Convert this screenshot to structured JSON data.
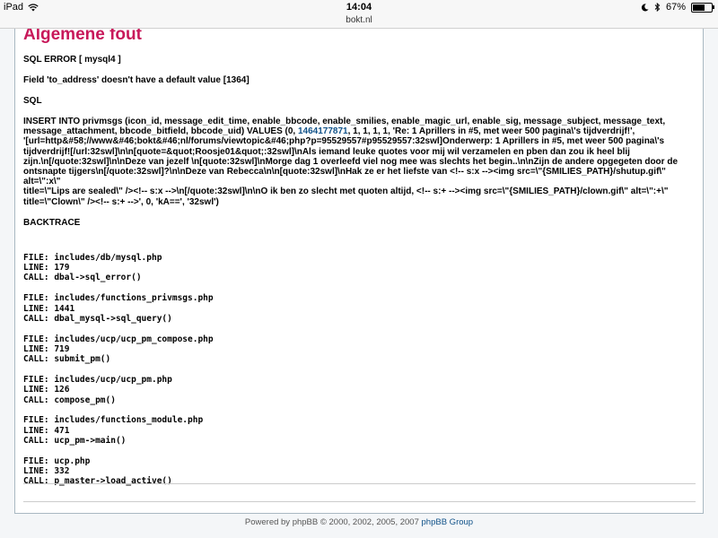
{
  "status_bar": {
    "device": "iPad",
    "time": "14:04",
    "battery": "67%"
  },
  "url_bar": {
    "domain": "bokt.nl"
  },
  "error": {
    "title": "Algemene fout",
    "sql_error": "SQL ERROR [ mysql4 ]",
    "field_message": "Field 'to_address' doesn't have a default value [1364]",
    "sql_heading": "SQL",
    "query_lines": [
      {
        "pre": "INSERT INTO privmsgs (icon_id, message_edit_time, enable_bbcode, enable_smilies, enable_magic_url, enable_sig, message_subject, message_text,",
        "link": "",
        "post": ""
      },
      {
        "pre": "message_attachment, bbcode_bitfield, bbcode_uid) VALUES (0, ",
        "link": "1464177871",
        "post": ", 1, 1, 1, 1, 'Re: 1 Aprillers in #5, met weer 500 pagina\\'s tijdverdrijf!',"
      },
      {
        "pre": "'[url=http&#58;//www&#46;bokt&#46;nl/forums/viewtopic&#46;php?p=95529557#p95529557:32swl]Onderwerp: 1 Aprillers in #5, met weer 500 pagina\\'s",
        "link": "",
        "post": ""
      },
      {
        "pre": "tijdverdrijf![/url:32swl]\\n\\n[quote=&quot;Roosje01&quot;:32swl]\\nAls iemand leuke quotes voor mij wil verzamelen en pben dan zou ik heel blij",
        "link": "",
        "post": ""
      },
      {
        "pre": "zijn.\\n[/quote:32swl]\\n\\nDeze van jezelf \\n[quote:32swl]\\nMorge dag 1 overleefd viel nog mee was slechts het begin..\\n\\nZijn de andere opgegeten door de",
        "link": "",
        "post": ""
      },
      {
        "pre": "ontsnapte tijgers\\n[/quote:32swl]?\\n\\nDeze van Rebecca\\n\\n[quote:32swl]\\nHak ze er het liefste van <!-- s:x --><img src=\\\"{SMILIES_PATH}/shutup.gif\\\" alt=\\\":x\\\"",
        "link": "",
        "post": ""
      },
      {
        "pre": "title=\\\"Lips are sealed\\\" /><!-- s:x -->\\n[/quote:32swl]\\n\\nO ik ben zo slecht met quoten altijd, <!-- s:+ --><img src=\\\"{SMILIES_PATH}/clown.gif\\\" alt=\\\":+\\\"",
        "link": "",
        "post": ""
      },
      {
        "pre": "title=\\\"Clown\\\" /><!-- s:+ -->', 0, 'kA==', '32swl')",
        "link": "",
        "post": ""
      }
    ],
    "backtrace_heading": "BACKTRACE",
    "backtrace": [
      {
        "file": "FILE: includes/db/mysql.php",
        "line": "LINE: 179",
        "call": "CALL: dbal->sql_error()"
      },
      {
        "file": "FILE: includes/functions_privmsgs.php",
        "line": "LINE: 1441",
        "call": "CALL: dbal_mysql->sql_query()"
      },
      {
        "file": "FILE: includes/ucp/ucp_pm_compose.php",
        "line": "LINE: 719",
        "call": "CALL: submit_pm()"
      },
      {
        "file": "FILE: includes/ucp/ucp_pm.php",
        "line": "LINE: 126",
        "call": "CALL: compose_pm()"
      },
      {
        "file": "FILE: includes/functions_module.php",
        "line": "LINE: 471",
        "call": "CALL: ucp_pm->main()"
      },
      {
        "file": "FILE: ucp.php",
        "line": "LINE: 332",
        "call": "CALL: p_master->load_active()"
      }
    ]
  },
  "footer": {
    "text": "Powered by phpBB © 2000, 2002, 2005, 2007 ",
    "link": "phpBB Group"
  }
}
